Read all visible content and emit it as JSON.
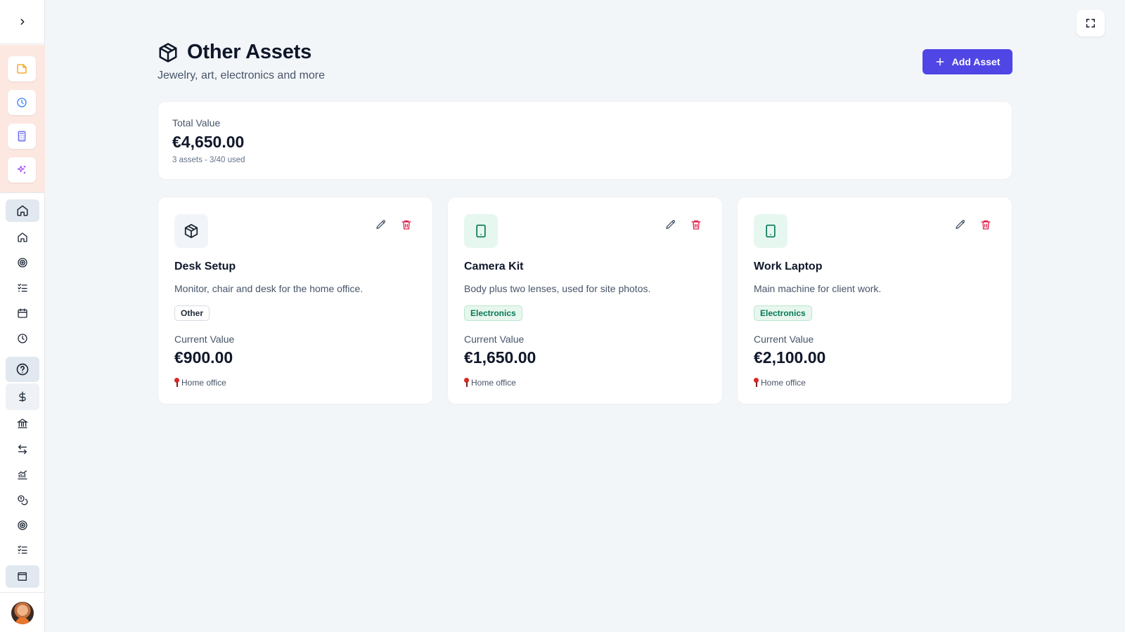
{
  "sidebar": {
    "toggle_icon": "chevron-right-icon",
    "quick_actions": [
      {
        "name": "notes",
        "icon": "sticky-note-icon",
        "color": "#f59e0b"
      },
      {
        "name": "history",
        "icon": "clock-icon",
        "color": "#3b82f6"
      },
      {
        "name": "calculator",
        "icon": "calculator-icon",
        "color": "#6366f1"
      },
      {
        "name": "ai-assistant",
        "icon": "sparkles-icon",
        "color": "#a855f7"
      }
    ],
    "nav_items": [
      {
        "name": "home",
        "icon": "home-icon",
        "active": true
      },
      {
        "name": "property",
        "icon": "house-icon"
      },
      {
        "name": "goals",
        "icon": "target-icon"
      },
      {
        "name": "checklist",
        "icon": "list-check-icon"
      },
      {
        "name": "calendar",
        "icon": "calendar-icon"
      },
      {
        "name": "history",
        "icon": "clock-icon"
      },
      {
        "name": "help",
        "icon": "help-circle-icon",
        "active": true
      },
      {
        "name": "money",
        "icon": "dollar-icon"
      },
      {
        "name": "bank",
        "icon": "bank-icon"
      },
      {
        "name": "transfers",
        "icon": "arrows-left-right-icon"
      },
      {
        "name": "analytics",
        "icon": "chart-line-icon"
      },
      {
        "name": "coins",
        "icon": "coins-icon"
      },
      {
        "name": "goals-2",
        "icon": "target-icon"
      },
      {
        "name": "checklist-2",
        "icon": "list-check-icon"
      },
      {
        "name": "wallet",
        "icon": "wallet-icon",
        "active": true
      }
    ]
  },
  "header": {
    "title": "Other Assets",
    "subtitle": "Jewelry, art, electronics and more",
    "add_button_label": "Add Asset"
  },
  "summary": {
    "label": "Total Value",
    "value": "€4,650.00",
    "meta": "3 assets - 3/40 used"
  },
  "assets": [
    {
      "name": "Desk Setup",
      "description": "Monitor, chair and desk for the home office.",
      "category": "Other",
      "icon": "package-icon",
      "value_label": "Current Value",
      "value": "€900.00",
      "location": "Home office"
    },
    {
      "name": "Camera Kit",
      "description": "Body plus two lenses, used for site photos.",
      "category": "Electronics",
      "icon": "tablet-icon",
      "value_label": "Current Value",
      "value": "€1,650.00",
      "location": "Home office"
    },
    {
      "name": "Work Laptop",
      "description": "Main machine for client work.",
      "category": "Electronics",
      "icon": "tablet-icon",
      "value_label": "Current Value",
      "value": "€2,100.00",
      "location": "Home office"
    }
  ],
  "colors": {
    "accent": "#4f46e5",
    "danger": "#e11d48",
    "electronics": "#047857"
  }
}
